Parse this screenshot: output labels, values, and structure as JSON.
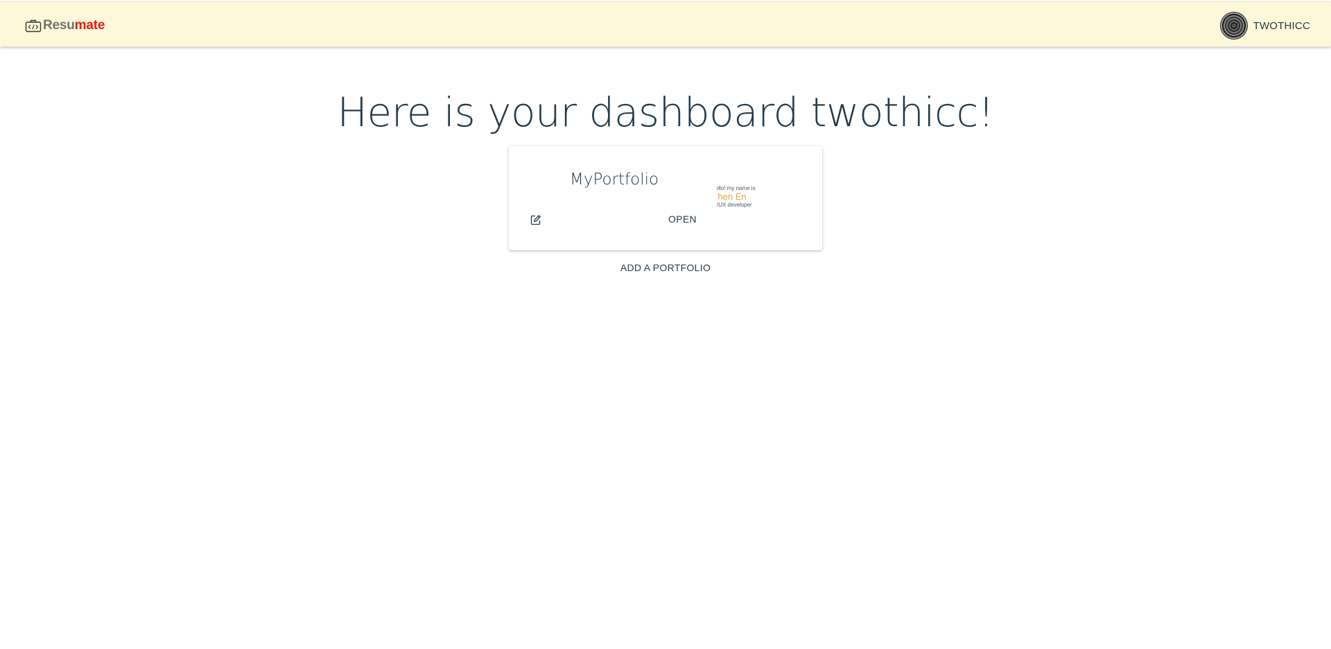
{
  "header": {
    "brand_part1": "Resu",
    "brand_part2": "mate",
    "brand_icon": "code-briefcase-icon",
    "username": "TWOTHICC",
    "avatar_icon": "avatar"
  },
  "main": {
    "headline": "Here is your dashboard twothicc!",
    "portfolios": [
      {
        "title": "MyPortfolio",
        "open_label": "OPEN",
        "edit_icon": "edit-icon",
        "thumbnail": {
          "line1": "Hello! my name is",
          "line2": "Chen En",
          "line3": "UI/UX developer"
        }
      }
    ],
    "add_label": "ADD A PORTFOLIO"
  },
  "colors": {
    "header_bg": "#fdf8d9",
    "brand_gray": "#747474",
    "brand_red": "#e31b1b",
    "text_dark": "#243b4c",
    "thumb_accent": "#e2a43a"
  }
}
